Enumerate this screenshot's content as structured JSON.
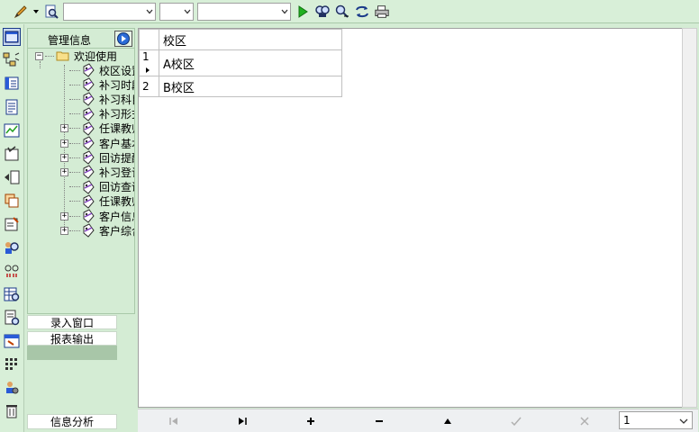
{
  "toolbar": {
    "combo1_value": "",
    "combo2_value": "",
    "combo3_value": ""
  },
  "tree": {
    "header": "管理信息",
    "root": "欢迎使用",
    "items": [
      {
        "label": "校区设置",
        "expandable": false
      },
      {
        "label": "补习时段",
        "expandable": false
      },
      {
        "label": "补习科目",
        "expandable": false
      },
      {
        "label": "补习形式",
        "expandable": false
      },
      {
        "label": "任课教师",
        "expandable": true
      },
      {
        "label": "客户基本",
        "expandable": true
      },
      {
        "label": "回访提醒",
        "expandable": true
      },
      {
        "label": "补习登记",
        "expandable": true
      },
      {
        "label": "回访查询",
        "expandable": false
      },
      {
        "label": "任课教师",
        "expandable": false
      },
      {
        "label": "客户信息",
        "expandable": true
      },
      {
        "label": "客户综合",
        "expandable": true
      }
    ]
  },
  "panels": {
    "entry_window": "录入窗口",
    "report_output": "报表输出",
    "info_analysis": "信息分析"
  },
  "grid": {
    "column": "校区",
    "rows": [
      {
        "num": "1",
        "value": "A校区",
        "current": true
      },
      {
        "num": "2",
        "value": "B校区",
        "current": false
      }
    ]
  },
  "navigator": {
    "page_value": "1"
  }
}
